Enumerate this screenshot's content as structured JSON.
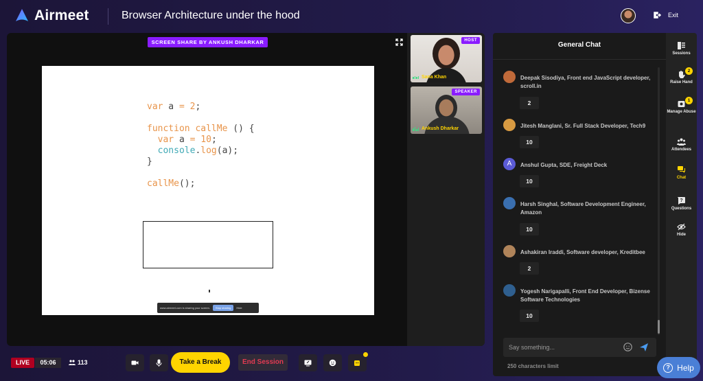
{
  "header": {
    "app_name": "Airmeet",
    "event_title": "Browser Architecture under the hood",
    "exit_label": "Exit"
  },
  "stage": {
    "screen_share_label": "SCREEN SHARE BY ANKUSH DHARKAR",
    "code_lines": [
      "var a = 2;",
      "",
      "function callMe () {",
      "  var a = 10;",
      "  console.log(a);",
      "}",
      "",
      "callMe();"
    ],
    "share_notice": "www.airmeet.com is sharing your screen.",
    "share_stop_label": "Stop sharing",
    "share_hide_label": "Hide",
    "tiles": [
      {
        "name": "Sana Khan",
        "tag": "HOST"
      },
      {
        "name": "Ankush Dharkar",
        "tag": "SPEAKER"
      }
    ]
  },
  "controls": {
    "live_label": "LIVE",
    "timer": "05:06",
    "attendee_count": "113",
    "take_break_label": "Take a Break",
    "end_session_label": "End Session",
    "icons": [
      "camera-icon",
      "microphone-icon",
      "screen-share-icon",
      "emoji-icon",
      "reactions-icon"
    ]
  },
  "chat": {
    "title": "General Chat",
    "messages": [
      {
        "author": "Deepak Sisodiya, Front end JavaScript developer, scroll.in",
        "text": "2",
        "avatar_color": "#c06a3a"
      },
      {
        "author": "Jitesh Manglani, Sr. Full Stack Developer, Tech9",
        "text": "10",
        "avatar_color": "#d79a42"
      },
      {
        "author": "Anshul Gupta, SDE, Freight Deck",
        "text": "10",
        "avatar_letter": "A",
        "avatar_color": "#5b5bd6"
      },
      {
        "author": "Harsh Singhal, Software Development Engineer, Amazon",
        "text": "10",
        "avatar_color": "#3a6fb0"
      },
      {
        "author": "Ashakiran Iraddi, Software developer, Kreditbee",
        "text": "2",
        "avatar_color": "#b0845a"
      },
      {
        "author": "Yogesh Narigapalli, Front End Developer, Bizense Software Technologies",
        "text": "10",
        "avatar_color": "#2f5f8f"
      }
    ],
    "input_placeholder": "Say something...",
    "chars_limit": "250 characters limit"
  },
  "rail": {
    "items": [
      {
        "label": "Sessions",
        "icon": "sessions-icon"
      },
      {
        "label": "Raise Hand",
        "icon": "hand-icon",
        "badge": "2"
      },
      {
        "label": "Manage Abuse",
        "icon": "shield-icon",
        "badge": "1"
      },
      {
        "label": "Attendees",
        "icon": "people-icon"
      },
      {
        "label": "Chat",
        "icon": "chat-icon",
        "active": true
      },
      {
        "label": "Questions",
        "icon": "question-icon"
      },
      {
        "label": "Hide",
        "icon": "eye-off-icon"
      }
    ]
  },
  "help_label": "Help",
  "colors": {
    "accent_purple": "#8a1cff",
    "live_red": "#b00020",
    "break_yellow": "#ffd400",
    "help_blue": "#4a7fd6"
  }
}
